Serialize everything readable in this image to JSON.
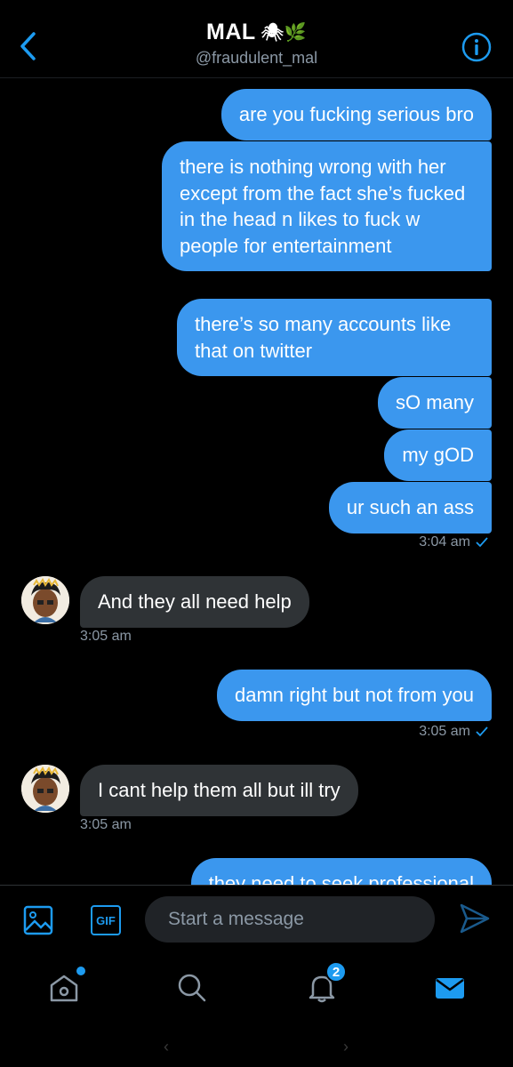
{
  "header": {
    "title": "MAL",
    "title_emoji": "🕷🌿",
    "handle": "@fraudulent_mal"
  },
  "messages": [
    {
      "dir": "out",
      "text": "are you fucking serious bro"
    },
    {
      "dir": "out",
      "text": "there is nothing wrong with her except from the fact she’s fucked in the head n likes to fuck w people for entertainment"
    },
    {
      "dir": "out",
      "text": "there’s so many accounts like that on twitter"
    },
    {
      "dir": "out",
      "text": "sO many"
    },
    {
      "dir": "out",
      "text": "my gOD"
    },
    {
      "dir": "out",
      "text": "ur such an ass"
    },
    {
      "dir": "in",
      "text": "And they all need help"
    },
    {
      "dir": "out",
      "text": "damn right but not from you"
    },
    {
      "dir": "in",
      "text": "I cant help them all but ill try"
    },
    {
      "dir": "out",
      "text": "they need to seek professional"
    }
  ],
  "timestamps": {
    "t1": "3:04 am",
    "t2": "3:05 am",
    "t3": "3:05 am",
    "t4": "3:05 am"
  },
  "composer": {
    "placeholder": "Start a message",
    "gif_label": "GIF"
  },
  "nav": {
    "notifications_count": "2"
  },
  "colors": {
    "accent": "#1d9bf0",
    "outgoing_bubble": "#3b97ee",
    "incoming_bubble": "#2f3336",
    "background": "#000000",
    "muted_text": "#8b98a5"
  },
  "icons": {
    "back": "chevron-left-icon",
    "info": "info-icon",
    "image": "image-icon",
    "gif": "gif-icon",
    "send": "send-icon",
    "home": "home-icon",
    "search": "search-icon",
    "notifications": "bell-icon",
    "messages": "mail-icon",
    "read_receipt": "check-icon"
  }
}
